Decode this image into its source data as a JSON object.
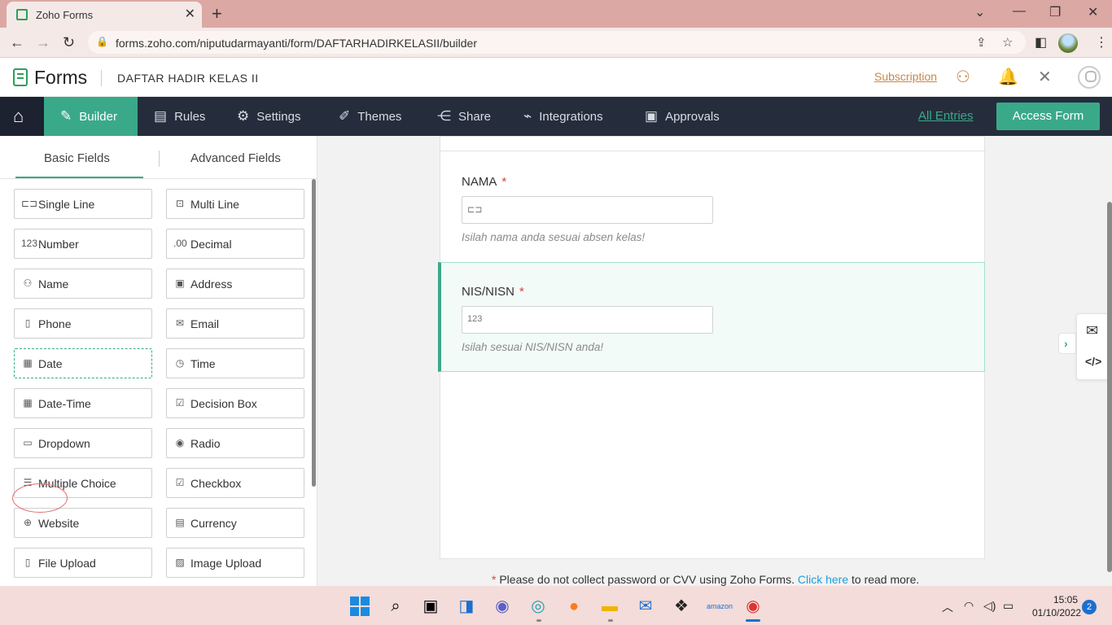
{
  "browser": {
    "tab_title": "Zoho Forms",
    "url": "forms.zoho.com/niputudarmayanti/form/DAFTARHADIRKELASII/builder"
  },
  "header": {
    "brand": "Forms",
    "form_name": "DAFTAR HADIR KELAS II",
    "subscription": "Subscription"
  },
  "nav": {
    "items": [
      {
        "label": "Builder",
        "icon": "builder-icon"
      },
      {
        "label": "Rules",
        "icon": "rules-icon"
      },
      {
        "label": "Settings",
        "icon": "gear-icon"
      },
      {
        "label": "Themes",
        "icon": "brush-icon"
      },
      {
        "label": "Share",
        "icon": "share-icon"
      },
      {
        "label": "Integrations",
        "icon": "plug-icon"
      },
      {
        "label": "Approvals",
        "icon": "approvals-icon"
      }
    ],
    "all_entries": "All Entries",
    "access_form": "Access Form"
  },
  "left_panel": {
    "tabs": [
      "Basic Fields",
      "Advanced Fields"
    ],
    "fields": [
      {
        "label": "Single Line",
        "icon": "⊏⊐"
      },
      {
        "label": "Multi Line",
        "icon": "⊡"
      },
      {
        "label": "Number",
        "icon": "123"
      },
      {
        "label": "Decimal",
        "icon": ".00"
      },
      {
        "label": "Name",
        "icon": "⚇"
      },
      {
        "label": "Address",
        "icon": "▣"
      },
      {
        "label": "Phone",
        "icon": "▯"
      },
      {
        "label": "Email",
        "icon": "✉"
      },
      {
        "label": "Date",
        "icon": "▦"
      },
      {
        "label": "Time",
        "icon": "◷"
      },
      {
        "label": "Date-Time",
        "icon": "▦"
      },
      {
        "label": "Decision Box",
        "icon": "☑"
      },
      {
        "label": "Dropdown",
        "icon": "▭"
      },
      {
        "label": "Radio",
        "icon": "◉"
      },
      {
        "label": "Multiple Choice",
        "icon": "☰"
      },
      {
        "label": "Checkbox",
        "icon": "☑"
      },
      {
        "label": "Website",
        "icon": "⊕"
      },
      {
        "label": "Currency",
        "icon": "▤"
      },
      {
        "label": "File Upload",
        "icon": "▯"
      },
      {
        "label": "Image Upload",
        "icon": "▨"
      }
    ]
  },
  "form": {
    "field1": {
      "label": "NAMA",
      "required": "*",
      "placeholder_icon": "⊏⊐",
      "help": "Isilah nama anda sesuai absen kelas!"
    },
    "field2": {
      "label": "NIS/NISN",
      "required": "*",
      "placeholder_icon": "123",
      "help": "Isilah sesuai NIS/NISN anda!"
    },
    "footnote": {
      "star": "*",
      "text": " Please do not collect password or CVV using Zoho Forms. ",
      "link": "Click here",
      "tail": " to read more."
    }
  },
  "taskbar": {
    "time": "15:05",
    "date": "01/10/2022",
    "notifications": "2"
  },
  "colors": {
    "accent": "#3aa98a",
    "nav_bg": "#252d3c",
    "required": "#e53935",
    "link": "#1f9fd8"
  }
}
